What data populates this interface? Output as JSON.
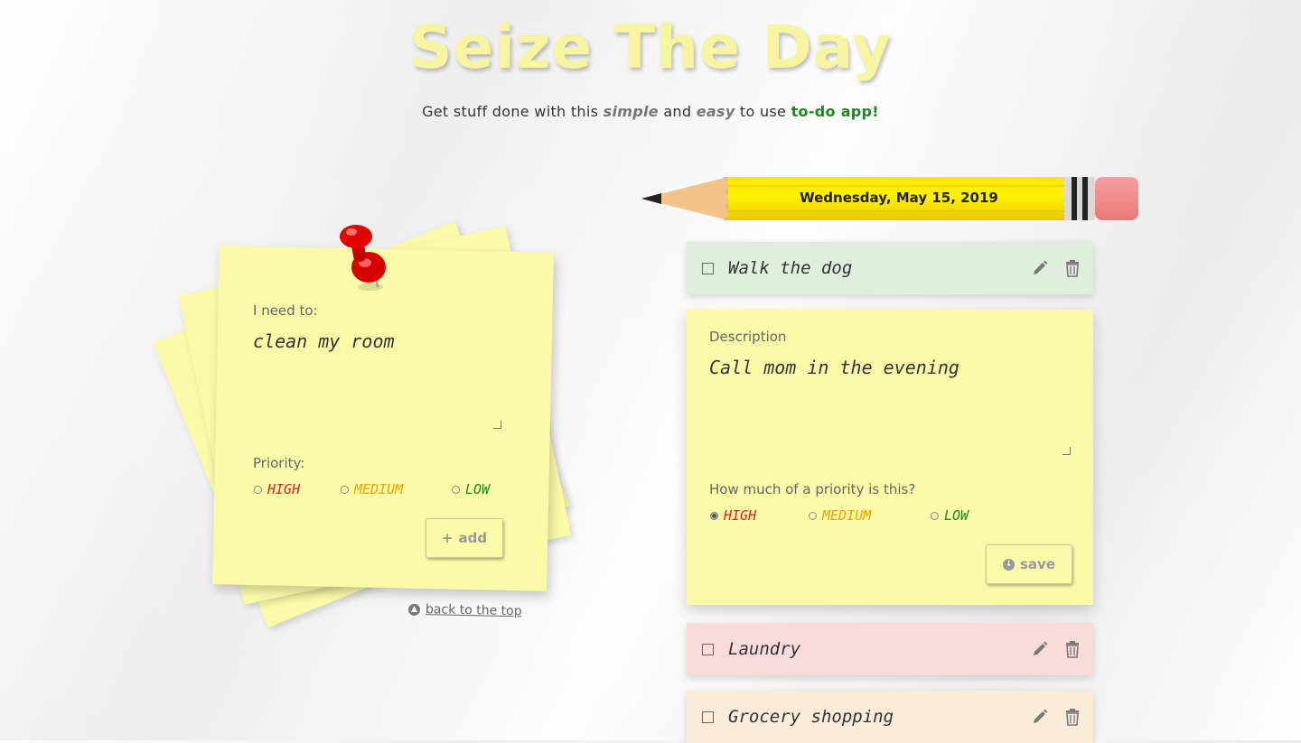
{
  "header": {
    "title": "Seize The Day",
    "subtitle_prefix": "Get stuff done with this",
    "subtitle_simple": "simple",
    "subtitle_and": "and",
    "subtitle_easy": "easy",
    "subtitle_to_use": "to use",
    "subtitle_app": "to-do app!"
  },
  "add_form": {
    "task_label": "I need to:",
    "task_value": "clean my room",
    "priority_label": "Priority:",
    "priorities": [
      "HIGH",
      "MEDIUM",
      "LOW"
    ],
    "selected_priority": "",
    "add_button": "add",
    "back_to_top": "back to the top"
  },
  "date": "Wednesday, May 15, 2019",
  "todos": [
    {
      "label": "Walk the dog",
      "color": "#dfeedd",
      "checked": false
    },
    {
      "label": "Laundry",
      "color": "#fadbdc",
      "checked": false
    },
    {
      "label": "Grocery shopping",
      "color": "#faecd8",
      "checked": false
    }
  ],
  "edit_form": {
    "description_label": "Description",
    "description_value": "Call mom in the evening",
    "priority_label": "How much of a priority is this?",
    "priorities": [
      "HIGH",
      "MEDIUM",
      "LOW"
    ],
    "selected_priority": "HIGH",
    "save_button": "save"
  },
  "colors": {
    "note_yellow": "#fbfaa8",
    "high": "#e02020",
    "medium": "#f0a000",
    "low": "#1e8a1e",
    "app_green": "#1e8a1e"
  },
  "icons": [
    "plus-icon",
    "pushpin-icon",
    "pencil-edit-icon",
    "trash-icon",
    "save-circle-icon",
    "chevron-up-circle-icon",
    "pencil-icon"
  ]
}
